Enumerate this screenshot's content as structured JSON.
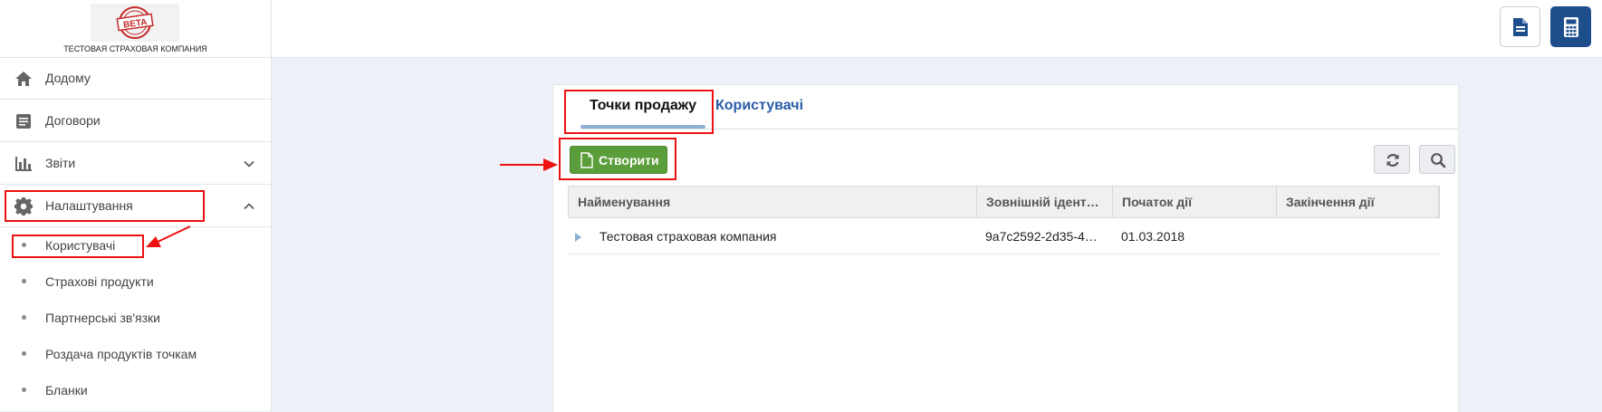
{
  "header": {
    "logo_badge": "BETA",
    "company_name": "ТЕСТОВАЯ СТРАХОВАЯ КОМПАНИЯ",
    "doc_button_icon": "document-icon",
    "calc_button_icon": "calculator-icon"
  },
  "sidebar": {
    "items": [
      {
        "label": "Додому",
        "icon": "home-icon"
      },
      {
        "label": "Договори",
        "icon": "document-list-icon"
      },
      {
        "label": "Звіти",
        "icon": "bar-chart-icon",
        "expanded": false
      },
      {
        "label": "Налаштування",
        "icon": "gear-icon",
        "expanded": true
      }
    ],
    "sub_items": [
      {
        "label": "Користувачі"
      },
      {
        "label": "Страхові продукти"
      },
      {
        "label": "Партнерські зв'язки"
      },
      {
        "label": "Роздача продуктів точкам"
      },
      {
        "label": "Бланки"
      }
    ]
  },
  "main": {
    "tabs": [
      {
        "label": "Точки продажу",
        "active": true
      },
      {
        "label": "Користувачі",
        "active": false
      }
    ],
    "create_label": "Створити",
    "refresh_icon": "refresh-icon",
    "search_icon": "search-icon",
    "table": {
      "columns": [
        "Найменування",
        "Зовнішній ідент…",
        "Початок дії",
        "Закінчення дії"
      ],
      "rows": [
        {
          "name": "Тестовая страховая компания",
          "external_id": "9a7c2592-2d35-4…",
          "start": "01.03.2018",
          "end": ""
        }
      ]
    }
  },
  "colors": {
    "accent_blue": "#1e4d8c",
    "tab_link": "#2b5ca8",
    "create_green": "#5a9d3a",
    "annotation_red": "#e11"
  }
}
